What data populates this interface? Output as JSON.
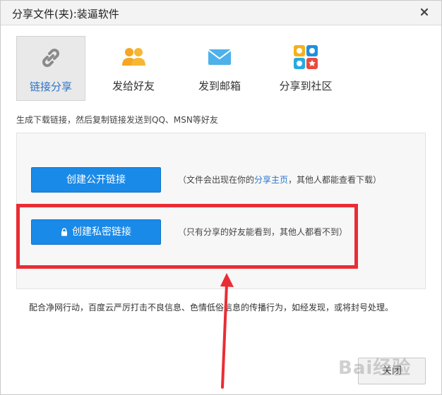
{
  "dialog": {
    "title": "分享文件(夹):装逼软件"
  },
  "tabs": [
    {
      "label": "链接分享",
      "icon": "link-icon",
      "active": true
    },
    {
      "label": "发给好友",
      "icon": "friends-icon",
      "active": false
    },
    {
      "label": "发到邮箱",
      "icon": "mail-icon",
      "active": false
    },
    {
      "label": "分享到社区",
      "icon": "community-icon",
      "active": false
    }
  ],
  "description": "生成下载链接，然后复制链接发送到QQ、MSN等好友",
  "public_link": {
    "button_label": "创建公开链接",
    "note_prefix": "（文件会出现在你的",
    "note_link": "分享主页",
    "note_suffix": "，其他人都能查看下载）"
  },
  "private_link": {
    "button_label": "创建私密链接",
    "note": "（只有分享的好友能看到，其他人都看不到）"
  },
  "footer_notice": "配合净网行动，百度云严厉打击不良信息、色情低俗信息的传播行为，如经发现，或将封号处理。",
  "close_button_label": "关闭",
  "watermark_text": "Bai经验",
  "colors": {
    "accent_blue": "#1a8ae8",
    "highlight_red": "#ea2d35",
    "link_blue": "#2b74c9"
  }
}
